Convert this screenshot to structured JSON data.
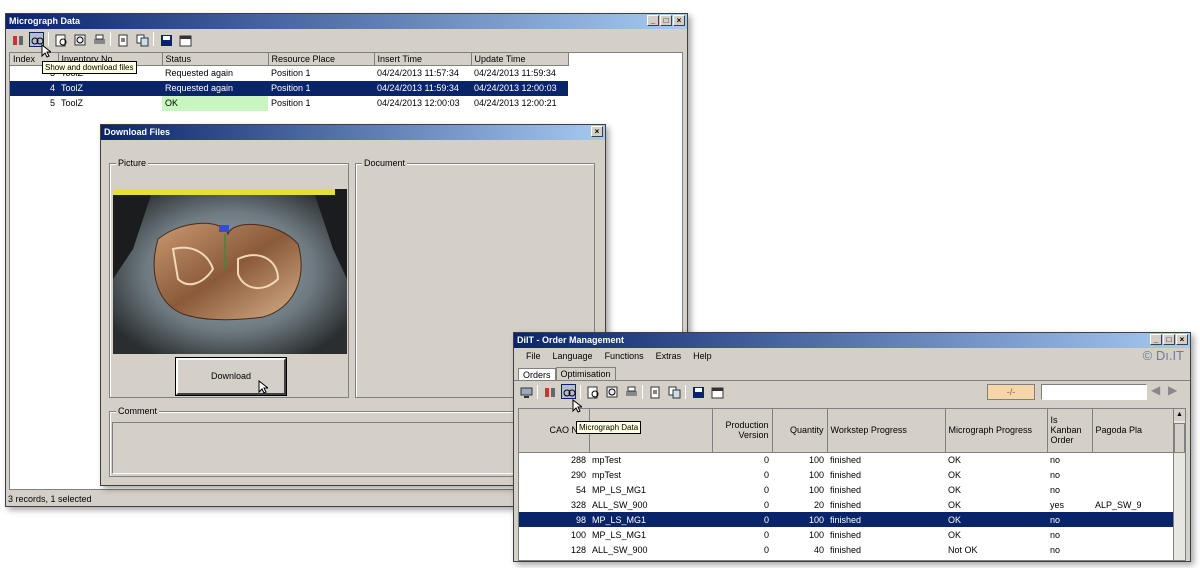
{
  "micro": {
    "title": "Micrograph Data",
    "tooltip": "Show and download files",
    "columns": [
      "Index",
      "Inventory No.",
      "Status",
      "Resource Place",
      "Insert Time",
      "Update Time"
    ],
    "rows": [
      {
        "index": "3",
        "inv": "ToolZ",
        "status": "Requested again",
        "place": "Position 1",
        "insert": "04/24/2013 11:57:34",
        "update": "04/24/2013 11:59:34"
      },
      {
        "index": "4",
        "inv": "ToolZ",
        "status": "Requested again",
        "place": "Position 1",
        "insert": "04/24/2013 11:59:34",
        "update": "04/24/2013 12:00:03"
      },
      {
        "index": "5",
        "inv": "ToolZ",
        "status": "OK",
        "place": "Position 1",
        "insert": "04/24/2013 12:00:03",
        "update": "04/24/2013 12:00:21"
      }
    ],
    "status": "3 records, 1 selected",
    "status_colors": {
      "ok": "#c8f5c0"
    }
  },
  "download": {
    "title": "Download Files",
    "picture_label": "Picture",
    "document_label": "Document",
    "download_label": "Download",
    "comment_label": "Comment"
  },
  "order": {
    "title": "DiIT - Order Management",
    "brand": "© Dı.IT",
    "menu": [
      "File",
      "Language",
      "Functions",
      "Extras",
      "Help"
    ],
    "tabs": [
      "Orders",
      "Optimisation"
    ],
    "nav_field": "-/-",
    "tooltip": "Micrograph Data",
    "columns": [
      "CAO No.",
      "Article",
      "Production Version",
      "Quantity",
      "Workstep Progress",
      "Micrograph Progress",
      "Is Kanban Order",
      "Pagoda Pla"
    ],
    "rows": [
      {
        "cao": "288",
        "article": "mpTest",
        "ver": "0",
        "qty": "100",
        "work": "finished",
        "micro": "OK",
        "kanban": "no",
        "pagoda": ""
      },
      {
        "cao": "290",
        "article": "mpTest",
        "ver": "0",
        "qty": "100",
        "work": "finished",
        "micro": "OK",
        "kanban": "no",
        "pagoda": ""
      },
      {
        "cao": "54",
        "article": "MP_LS_MG1",
        "ver": "0",
        "qty": "100",
        "work": "finished",
        "micro": "OK",
        "kanban": "no",
        "pagoda": ""
      },
      {
        "cao": "328",
        "article": "ALL_SW_900",
        "ver": "0",
        "qty": "20",
        "work": "finished",
        "micro": "OK",
        "kanban": "yes",
        "pagoda": "ALP_SW_9"
      },
      {
        "cao": "98",
        "article": "MP_LS_MG1",
        "ver": "0",
        "qty": "100",
        "work": "finished",
        "micro": "OK",
        "kanban": "no",
        "pagoda": ""
      },
      {
        "cao": "100",
        "article": "MP_LS_MG1",
        "ver": "0",
        "qty": "100",
        "work": "finished",
        "micro": "OK",
        "kanban": "no",
        "pagoda": ""
      },
      {
        "cao": "128",
        "article": "ALL_SW_900",
        "ver": "0",
        "qty": "40",
        "work": "finished",
        "micro": "Not OK",
        "kanban": "no",
        "pagoda": ""
      }
    ]
  },
  "colors": {
    "title_start": "#0a246a",
    "title_end": "#a6caf0",
    "selection": "#0a246a",
    "window_bg": "#d4d0c8",
    "nav_field": "#f6d6a8"
  }
}
